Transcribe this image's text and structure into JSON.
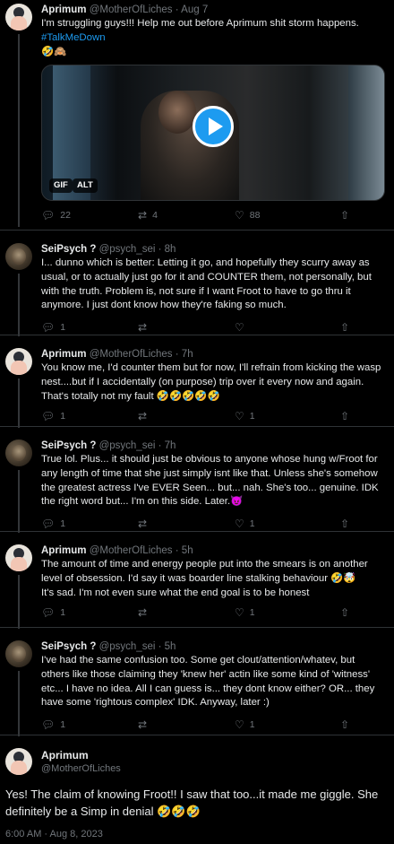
{
  "tweets": [
    {
      "name": "Aprimum",
      "handle": "@MotherOfLiches",
      "date": "Aug 7",
      "text": "I'm struggling guys!!! Help me out before Aprimum shit storm happens.",
      "hashtag": "#TalkMeDown",
      "emoji": "🤣🙈",
      "media_badges": [
        "GIF",
        "ALT"
      ],
      "replies": "22",
      "retweets": "4",
      "likes": "88"
    },
    {
      "name": "SeiPsych ?",
      "handle": "@psych_sei",
      "date": "8h",
      "text": "I... dunno which is better: Letting it go, and hopefully they scurry away as usual, or to actually just go for it and COUNTER them, not personally, but with the truth. Problem is, not sure if I want Froot to have to go thru it anymore. I just dont know how they're faking so much.",
      "replies": "1",
      "retweets": "",
      "likes": ""
    },
    {
      "name": "Aprimum",
      "handle": "@MotherOfLiches",
      "date": "7h",
      "text": "You know me, I'd counter them but for now, I'll refrain from kicking the wasp nest....but if I accidentally (on purpose) trip over it every now and again.  That's totally not my fault 🤣🤣🤣🤣🤣",
      "replies": "1",
      "retweets": "",
      "likes": "1"
    },
    {
      "name": "SeiPsych ?",
      "handle": "@psych_sei",
      "date": "7h",
      "text": "True lol. Plus... it should just be obvious to anyone whose hung w/Froot for any length of time that she just simply isnt like that. Unless she's somehow the greatest actress I've EVER Seen... but... nah. She's too... genuine. IDK the right word but... I'm on this side. Later.😈",
      "replies": "1",
      "retweets": "",
      "likes": "1"
    },
    {
      "name": "Aprimum",
      "handle": "@MotherOfLiches",
      "date": "5h",
      "text": "The amount of time and energy people put into the smears is on another level of obsession. I'd say it was boarder line stalking behaviour 🤣🤯",
      "text2": "It's sad. I'm not even sure what the end goal is to be honest",
      "replies": "1",
      "retweets": "",
      "likes": "1"
    },
    {
      "name": "SeiPsych ?",
      "handle": "@psych_sei",
      "date": "5h",
      "text": "I've had the same confusion too. Some get clout/attention/whatev, but others like those claiming they 'knew her' actin like some kind of 'witness' etc... I have no idea. All I can guess is... they dont know either? OR... they have some 'rightous complex' IDK. Anyway, later :)",
      "replies": "1",
      "retweets": "",
      "likes": "1"
    }
  ],
  "main_tweet": {
    "name": "Aprimum",
    "handle": "@MotherOfLiches",
    "text": "Yes! The claim of knowing Froot!! I saw that too...it made me giggle. She definitely be a Simp in denial 🤣🤣🤣",
    "timestamp": "6:00 AM · Aug 8, 2023"
  }
}
